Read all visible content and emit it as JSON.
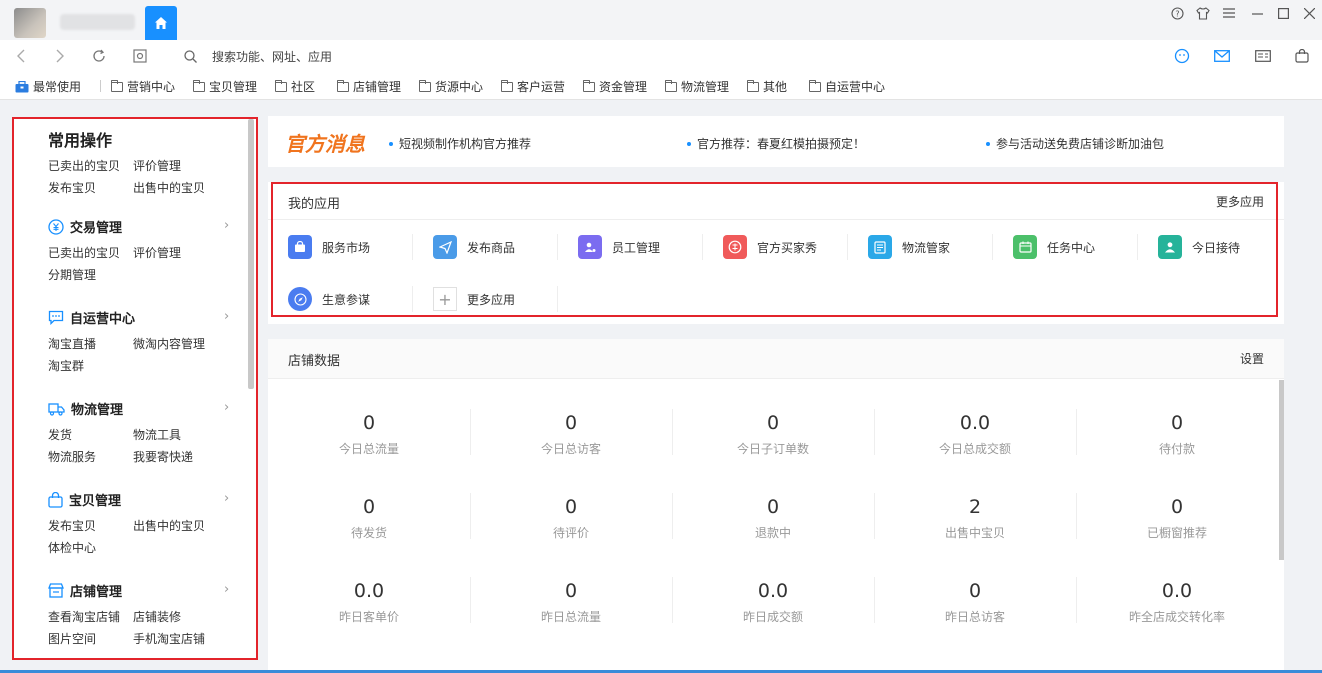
{
  "window": {
    "home_icon": "home-icon",
    "controls": [
      "help-icon",
      "skin-icon",
      "menu-icon",
      "minimize-icon",
      "maximize-icon",
      "close-icon"
    ]
  },
  "addressbar": {
    "search_placeholder": "搜索功能、网址、应用"
  },
  "bookmarks": [
    {
      "label": "最常使用"
    },
    {
      "label": "营销中心"
    },
    {
      "label": "宝贝管理"
    },
    {
      "label": "社区"
    },
    {
      "label": "店铺管理"
    },
    {
      "label": "货源中心"
    },
    {
      "label": "客户运营"
    },
    {
      "label": "资金管理"
    },
    {
      "label": "物流管理"
    },
    {
      "label": "其他"
    },
    {
      "label": "自运营中心"
    }
  ],
  "sidebar": {
    "groups": [
      {
        "title": "常用操作",
        "links": [
          "已卖出的宝贝",
          "评价管理",
          "发布宝贝",
          "出售中的宝贝"
        ]
      },
      {
        "title": "交易管理",
        "links": [
          "已卖出的宝贝",
          "评价管理",
          "分期管理"
        ]
      },
      {
        "title": "自运营中心",
        "links": [
          "淘宝直播",
          "微淘内容管理",
          "淘宝群"
        ]
      },
      {
        "title": "物流管理",
        "links": [
          "发货",
          "物流工具",
          "物流服务",
          "我要寄快递"
        ]
      },
      {
        "title": "宝贝管理",
        "links": [
          "发布宝贝",
          "出售中的宝贝",
          "体检中心"
        ]
      },
      {
        "title": "店铺管理",
        "links": [
          "查看淘宝店铺",
          "店铺装修",
          "图片空间",
          "手机淘宝店铺"
        ]
      }
    ]
  },
  "messages": {
    "logo": "官方消息",
    "items": [
      "短视频制作机构官方推荐",
      "官方推荐：春夏红模拍摄预定！",
      "参与活动送免费店铺诊断加油包"
    ]
  },
  "my_apps": {
    "title": "我的应用",
    "more": "更多应用",
    "apps": [
      {
        "label": "服务市场",
        "color": "#4a7cf0"
      },
      {
        "label": "发布商品",
        "color": "#4a9be8"
      },
      {
        "label": "员工管理",
        "color": "#7b6cf0"
      },
      {
        "label": "官方买家秀",
        "color": "#f05a5a"
      },
      {
        "label": "物流管家",
        "color": "#2aa8e8"
      },
      {
        "label": "任务中心",
        "color": "#4cc06a"
      },
      {
        "label": "今日接待",
        "color": "#26b39a"
      },
      {
        "label": "生意参谋",
        "color": "#4a7cf0"
      },
      {
        "label": "更多应用",
        "color": "#999999"
      }
    ]
  },
  "store_data": {
    "title": "店铺数据",
    "settings": "设置",
    "stats": [
      {
        "value": "0",
        "label": "今日总流量"
      },
      {
        "value": "0",
        "label": "今日总访客"
      },
      {
        "value": "0",
        "label": "今日子订单数"
      },
      {
        "value": "0.0",
        "label": "今日总成交额"
      },
      {
        "value": "0",
        "label": "待付款"
      },
      {
        "value": "0",
        "label": "待发货"
      },
      {
        "value": "0",
        "label": "待评价"
      },
      {
        "value": "0",
        "label": "退款中"
      },
      {
        "value": "2",
        "label": "出售中宝贝"
      },
      {
        "value": "0",
        "label": "已橱窗推荐"
      },
      {
        "value": "0.0",
        "label": "昨日客单价"
      },
      {
        "value": "0",
        "label": "昨日总流量"
      },
      {
        "value": "0.0",
        "label": "昨日成交额"
      },
      {
        "value": "0",
        "label": "昨日总访客"
      },
      {
        "value": "0.0",
        "label": "昨全店成交转化率"
      }
    ]
  }
}
